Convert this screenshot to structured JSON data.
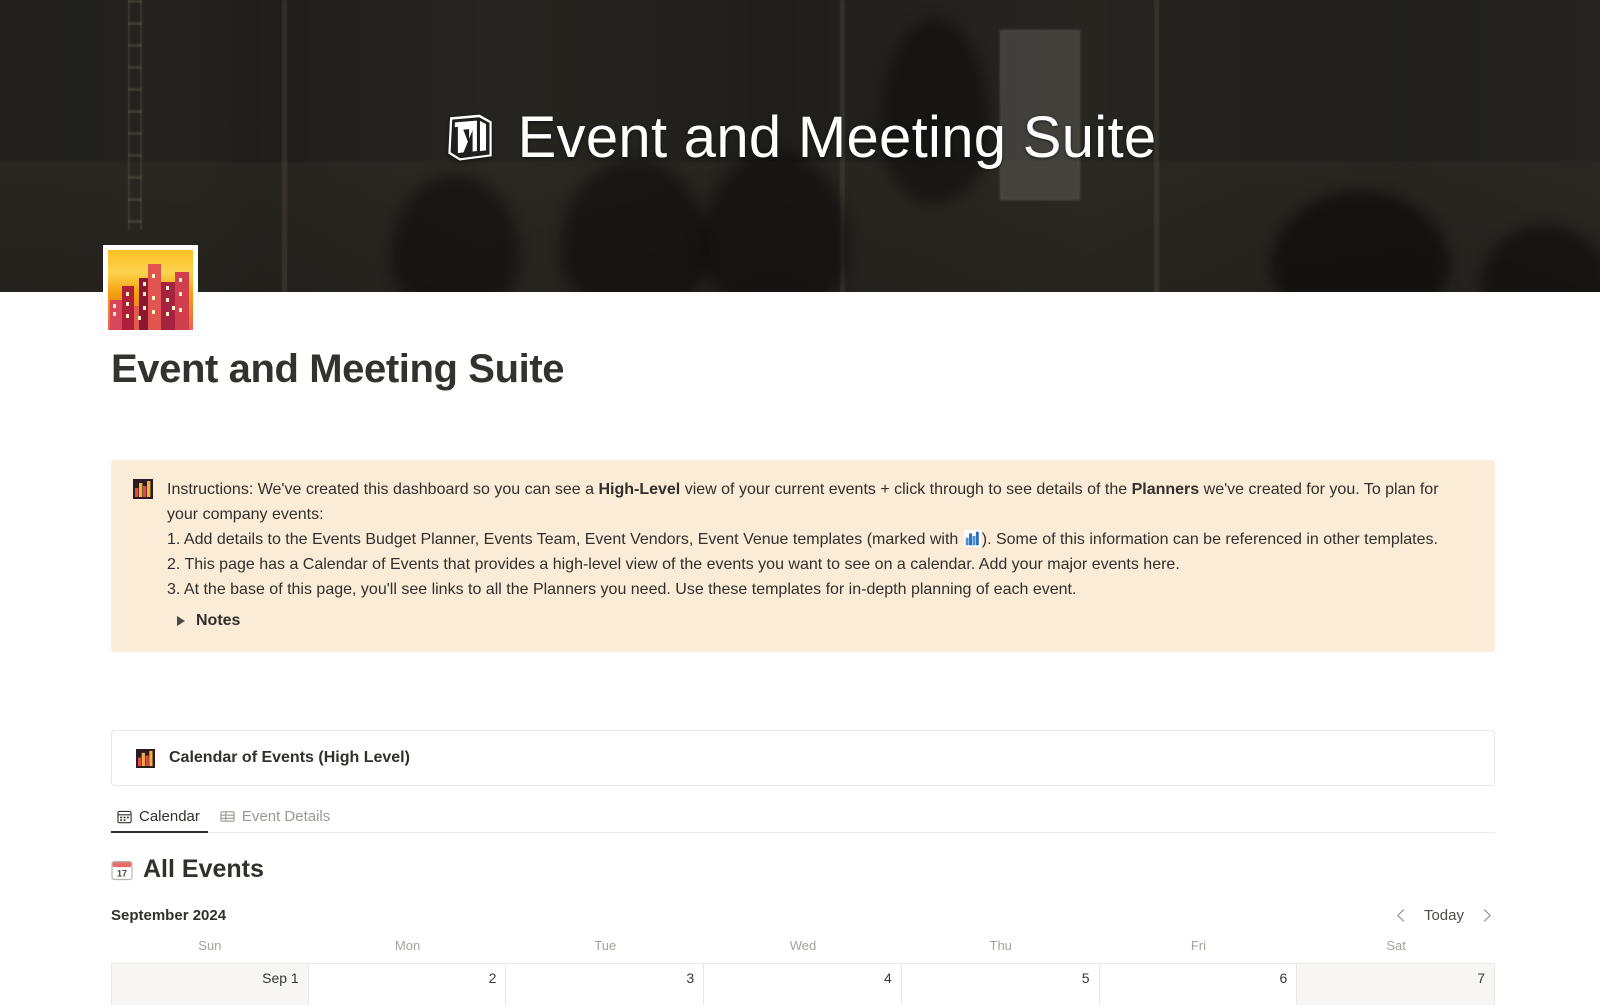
{
  "cover": {
    "title": "Event and Meeting Suite",
    "logo_icon": "notion-logo-icon"
  },
  "page": {
    "icon": "cityscape-at-dusk-emoji",
    "title": "Event and Meeting Suite"
  },
  "callout": {
    "icon": "bar-chart-emoji",
    "intro_prefix": "Instructions: We've created this dashboard so you can see a ",
    "intro_bold1": "High-Level",
    "intro_mid": " view of your current events + click through to see details of the ",
    "intro_bold2": "Planners",
    "intro_suffix": " we've created for you. To plan for your company events:",
    "step1_prefix": "1. Add details to the Events Budget Planner, Events Team, Event Vendors, Event Venue templates (marked with ",
    "step1_suffix": "). Some of this information can be referenced in other templates.",
    "step2": "2. This page has a Calendar of Events that provides a high-level view of the events you want to see on a calendar. Add your major events here.",
    "step3": "3. At the base of this page, you'll see links to all the Planners you need. Use these templates for in-depth planning of each event.",
    "notes_label": "Notes",
    "bg_color": "#faecd7"
  },
  "database": {
    "card_icon": "bar-chart-emoji",
    "card_title": "Calendar of Events (High Level)",
    "tabs": [
      {
        "label": "Calendar",
        "icon": "calendar-icon",
        "active": true
      },
      {
        "label": "Event Details",
        "icon": "table-icon",
        "active": false
      }
    ],
    "view_title": "All Events",
    "view_title_icon": "calendar-date-emoji"
  },
  "calendar": {
    "month_label": "September 2024",
    "today_label": "Today",
    "prev_icon": "chevron-left-icon",
    "next_icon": "chevron-right-icon",
    "weekdays": [
      "Sun",
      "Mon",
      "Tue",
      "Wed",
      "Thu",
      "Fri",
      "Sat"
    ],
    "weeks": [
      [
        {
          "label": "Sep 1",
          "weekend": true
        },
        {
          "label": "2",
          "weekend": false
        },
        {
          "label": "3",
          "weekend": false
        },
        {
          "label": "4",
          "weekend": false
        },
        {
          "label": "5",
          "weekend": false
        },
        {
          "label": "6",
          "weekend": false
        },
        {
          "label": "7",
          "weekend": true
        }
      ]
    ]
  }
}
